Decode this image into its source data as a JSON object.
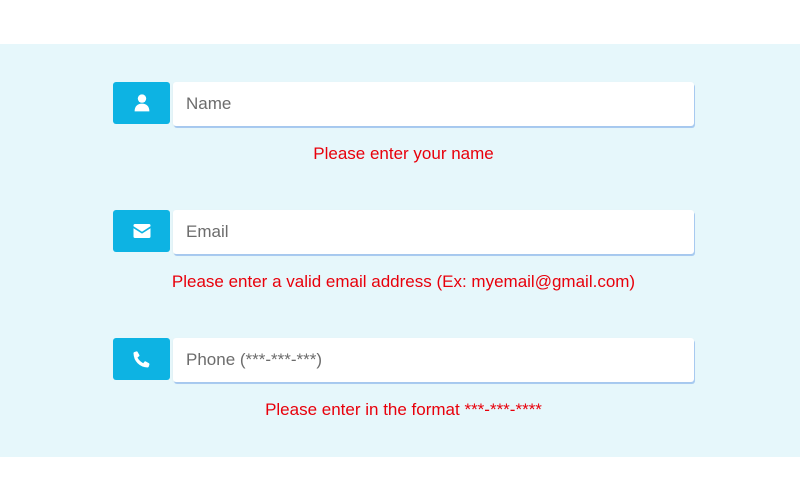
{
  "colors": {
    "panel_background": "#e6f7fb",
    "icon_background": "#0db3e3",
    "error_text": "#e8000b"
  },
  "form": {
    "fields": [
      {
        "icon": "user-icon",
        "placeholder": "Name",
        "value": "",
        "error": "Please enter your name"
      },
      {
        "icon": "envelope-icon",
        "placeholder": "Email",
        "value": "",
        "error": "Please enter a valid email address (Ex: myemail@gmail.com)"
      },
      {
        "icon": "phone-icon",
        "placeholder": "Phone (***-***-***)",
        "value": "",
        "error": "Please enter in the format ***-***-****"
      }
    ]
  }
}
